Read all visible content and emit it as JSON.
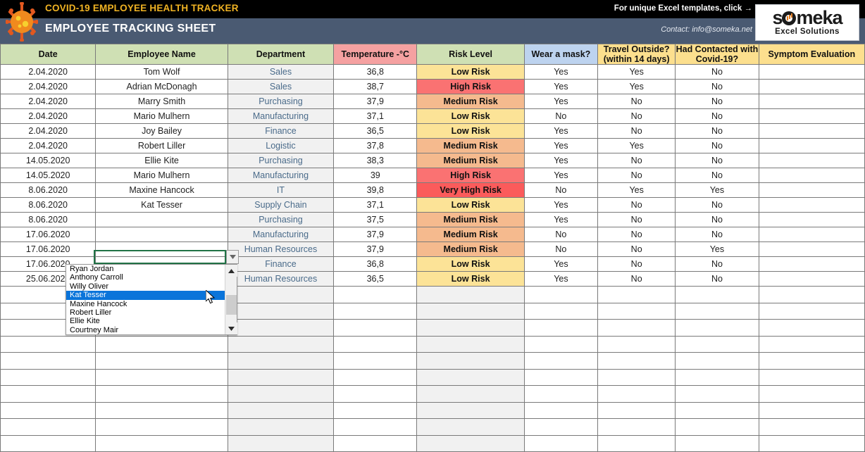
{
  "header": {
    "brand_title": "COVID-19 EMPLOYEE HEALTH TRACKER",
    "sheet_title": "EMPLOYEE TRACKING SHEET",
    "promo": "For unique Excel templates, click →",
    "contact": "Contact: info@someka.net",
    "logo_top": "someka",
    "logo_bottom": "Excel Solutions",
    "colors": {
      "brand_yellow": "#f0b323",
      "header_band": "#4a5a72",
      "header_top": "#000000"
    }
  },
  "table": {
    "columns": [
      {
        "label": "Date",
        "style": "green"
      },
      {
        "label": "Employee Name",
        "style": "green"
      },
      {
        "label": "Department",
        "style": "green"
      },
      {
        "label": "Temperature -°C",
        "style": "red"
      },
      {
        "label": "Risk Level",
        "style": "green"
      },
      {
        "label": "Wear a mask?",
        "style": "blue"
      },
      {
        "label": "Travel Outside? (within 14 days)",
        "style": "yellow",
        "line1": "Travel Outside?",
        "line2": "(within 14 days)"
      },
      {
        "label": "Had Contacted with Covid-19?",
        "style": "yellow",
        "line1": "Had Contacted with",
        "line2": "Covid-19?"
      },
      {
        "label": "Symptom Evaluation",
        "style": "yellow"
      }
    ],
    "rows": [
      {
        "date": "2.04.2020",
        "name": "Tom Wolf",
        "dept": "Sales",
        "temp": "36,8",
        "risk": "Low Risk",
        "risk_class": "risk-low",
        "mask": "Yes",
        "travel": "Yes",
        "contact": "No",
        "symptom": ""
      },
      {
        "date": "2.04.2020",
        "name": "Adrian McDonagh",
        "dept": "Sales",
        "temp": "38,7",
        "risk": "High Risk",
        "risk_class": "risk-high",
        "mask": "Yes",
        "travel": "Yes",
        "contact": "No",
        "symptom": ""
      },
      {
        "date": "2.04.2020",
        "name": "Marry Smith",
        "dept": "Purchasing",
        "temp": "37,9",
        "risk": "Medium Risk",
        "risk_class": "risk-med",
        "mask": "Yes",
        "travel": "No",
        "contact": "No",
        "symptom": ""
      },
      {
        "date": "2.04.2020",
        "name": "Mario Mulhern",
        "dept": "Manufacturing",
        "temp": "37,1",
        "risk": "Low Risk",
        "risk_class": "risk-low",
        "mask": "No",
        "travel": "No",
        "contact": "No",
        "symptom": ""
      },
      {
        "date": "2.04.2020",
        "name": "Joy Bailey",
        "dept": "Finance",
        "temp": "36,5",
        "risk": "Low Risk",
        "risk_class": "risk-low",
        "mask": "Yes",
        "travel": "No",
        "contact": "No",
        "symptom": ""
      },
      {
        "date": "2.04.2020",
        "name": "Robert Liller",
        "dept": "Logistic",
        "temp": "37,8",
        "risk": "Medium Risk",
        "risk_class": "risk-med",
        "mask": "Yes",
        "travel": "Yes",
        "contact": "No",
        "symptom": ""
      },
      {
        "date": "14.05.2020",
        "name": "Ellie Kite",
        "dept": "Purchasing",
        "temp": "38,3",
        "risk": "Medium Risk",
        "risk_class": "risk-med",
        "mask": "Yes",
        "travel": "No",
        "contact": "No",
        "symptom": ""
      },
      {
        "date": "14.05.2020",
        "name": "Mario Mulhern",
        "dept": "Manufacturing",
        "temp": "39",
        "risk": "High Risk",
        "risk_class": "risk-high",
        "mask": "Yes",
        "travel": "No",
        "contact": "No",
        "symptom": ""
      },
      {
        "date": "8.06.2020",
        "name": "Maxine Hancock",
        "dept": "IT",
        "temp": "39,8",
        "risk": "Very High Risk",
        "risk_class": "risk-vhigh",
        "mask": "No",
        "travel": "Yes",
        "contact": "Yes",
        "symptom": ""
      },
      {
        "date": "8.06.2020",
        "name": "Kat Tesser",
        "dept": "Supply Chain",
        "temp": "37,1",
        "risk": "Low Risk",
        "risk_class": "risk-low",
        "mask": "Yes",
        "travel": "No",
        "contact": "No",
        "symptom": ""
      },
      {
        "date": "8.06.2020",
        "name": "",
        "dept": "Purchasing",
        "temp": "37,5",
        "risk": "Medium Risk",
        "risk_class": "risk-med",
        "mask": "Yes",
        "travel": "No",
        "contact": "No",
        "symptom": ""
      },
      {
        "date": "17.06.2020",
        "name": "",
        "dept": "Manufacturing",
        "temp": "37,9",
        "risk": "Medium Risk",
        "risk_class": "risk-med",
        "mask": "No",
        "travel": "No",
        "contact": "No",
        "symptom": ""
      },
      {
        "date": "17.06.2020",
        "name": "",
        "dept": "Human Resources",
        "temp": "37,9",
        "risk": "Medium Risk",
        "risk_class": "risk-med",
        "mask": "No",
        "travel": "No",
        "contact": "Yes",
        "symptom": ""
      },
      {
        "date": "17.06.2020",
        "name": "",
        "dept": "Finance",
        "temp": "36,8",
        "risk": "Low Risk",
        "risk_class": "risk-low",
        "mask": "Yes",
        "travel": "No",
        "contact": "No",
        "symptom": ""
      },
      {
        "date": "25.06.2020",
        "name": "",
        "dept": "Human Resources",
        "temp": "36,5",
        "risk": "Low Risk",
        "risk_class": "risk-low",
        "mask": "Yes",
        "travel": "No",
        "contact": "No",
        "symptom": ""
      }
    ],
    "empty_row_count": 10,
    "risk_colors": {
      "low": "#fce397",
      "medium": "#f5ba8e",
      "high": "#fa7272",
      "very_high": "#fb5b5b"
    }
  },
  "active_cell": {
    "value": "Kat Tesser",
    "column": "Employee Name"
  },
  "dropdown": {
    "open": true,
    "selected": "Kat Tesser",
    "options": [
      "Ryan Jordan",
      "Anthony Carroll",
      "Willy Oliver",
      "Kat Tesser",
      "Maxine Hancock",
      "Robert Liller",
      "Ellie Kite",
      "Courtney Mair"
    ]
  }
}
